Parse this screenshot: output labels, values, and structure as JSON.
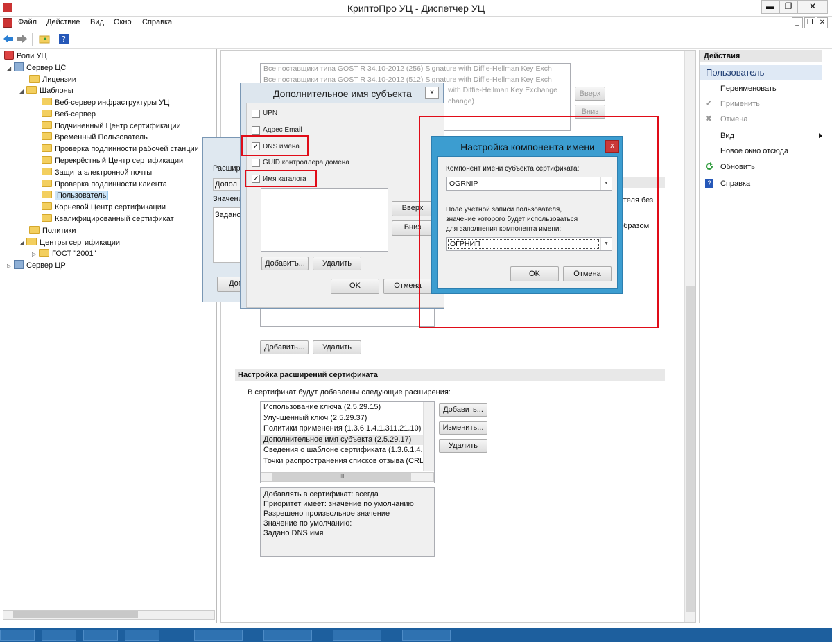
{
  "window": {
    "title": "КриптоПро УЦ - Диспетчер УЦ",
    "controls": {
      "min": "▬",
      "restore": "❐",
      "close": "✕"
    }
  },
  "menu": [
    "Файл",
    "Действие",
    "Вид",
    "Окно",
    "Справка"
  ],
  "mdi_controls": {
    "min": "_",
    "restore": "❐",
    "close": "✕"
  },
  "toolbar": {
    "icons": [
      "back-icon",
      "forward-icon",
      "up-folder-icon",
      "help-icon"
    ]
  },
  "tree": {
    "root": "Роли УЦ",
    "server_cs": "Сервер ЦС",
    "licenses": "Лицензии",
    "templates": "Шаблоны",
    "template_items": [
      "Веб-сервер инфраструктуры УЦ",
      "Веб-сервер",
      "Подчиненный Центр сертификации",
      "Временный Пользователь",
      "Проверка подлинности рабочей станции",
      "Перекрёстный Центр сертификации",
      "Защита электронной почты",
      "Проверка подлинности клиента",
      "Пользователь",
      "Корневой Центр сертификации",
      "Квалифицированный сертификат"
    ],
    "policies": "Политики",
    "cas": "Центры сертификации",
    "gost": "ГОСТ \"2001\"",
    "server_cr": "Сервер ЦР"
  },
  "middle": {
    "providers": [
      "Все поставщики типа GOST R 34.10-2012 (256) Signature with Diffie-Hellman Key Exch",
      "Все поставщики типа GOST R 34.10-2012 (512) Signature with Diffie-Hellman Key Exch",
      "with Diffie-Hellman Key Exchange",
      "change)"
    ],
    "up_label": "Вверх",
    "down_label": "Вниз",
    "right_text_1": "ателя без",
    "right_text_2": "образом",
    "add_label": "Добавить...",
    "delete_label": "Удалить",
    "ext_header": "Настройка расширений сертификата",
    "ext_caption": "В сертификат будут добавлены следующие расширения:",
    "ext_items": [
      "Использование ключа (2.5.29.15)",
      "Улучшенный ключ (2.5.29.37)",
      "Политики применения (1.3.6.1.4.1.311.21.10)",
      "Дополнительное имя субъекта (2.5.29.17)",
      "Сведения о шаблоне сертификата (1.3.6.1.4.1.",
      "Точки распространения списков отзыва (CRL"
    ],
    "ext_add": "Добавить...",
    "ext_edit": "Изменить...",
    "ext_delete": "Удалить",
    "details": [
      "Добавлять в сертификат: всегда",
      "Приоритет имеет: значение по умолчанию",
      "Разрешено произвольное значение",
      "Значение по умолчанию:",
      "Задано DNS имя"
    ],
    "scroll_thumb": "III"
  },
  "back_dialog": {
    "label1": "Расшире",
    "field1": "Допол",
    "label2": "Значени",
    "field2": "Задано",
    "btn": "Допо"
  },
  "san_dialog": {
    "title": "Дополнительное имя субъекта",
    "close": "x",
    "options": [
      {
        "label": "UPN",
        "checked": false
      },
      {
        "label": "Адрес Email",
        "checked": false
      },
      {
        "label": "DNS имена",
        "checked": true
      },
      {
        "label": "GUID контроллера домена",
        "checked": false
      },
      {
        "label": "Имя каталога",
        "checked": true
      }
    ],
    "up": "Вверх",
    "down": "Вниз",
    "add": "Добавить...",
    "delete": "Удалить",
    "ok": "OK",
    "cancel": "Отмена"
  },
  "comp_dialog": {
    "title": "Настройка компонента имени",
    "close": "x",
    "label1": "Компонент имени субъекта сертификата:",
    "value1": "OGRNIP",
    "label2a": "Поле учётной записи пользователя,",
    "label2b": "значение которого будет использоваться",
    "label2c": "для заполнения компонента имени:",
    "value2": "ОГРНИП",
    "ok": "OK",
    "cancel": "Отмена"
  },
  "actions": {
    "header": "Действия",
    "sub": "Пользователь",
    "items": [
      {
        "label": "Переименовать",
        "enabled": true
      },
      {
        "label": "Применить",
        "enabled": false
      },
      {
        "label": "Отмена",
        "enabled": false
      },
      {
        "label": "Вид",
        "enabled": true
      },
      {
        "label": "Новое окно отсюда",
        "enabled": true
      },
      {
        "label": "Обновить",
        "enabled": true
      },
      {
        "label": "Справка",
        "enabled": true
      }
    ]
  },
  "colors": {
    "accent": "#3c9dd0",
    "highlight": "#e00c18",
    "taskbar": "#1d5f9e"
  }
}
